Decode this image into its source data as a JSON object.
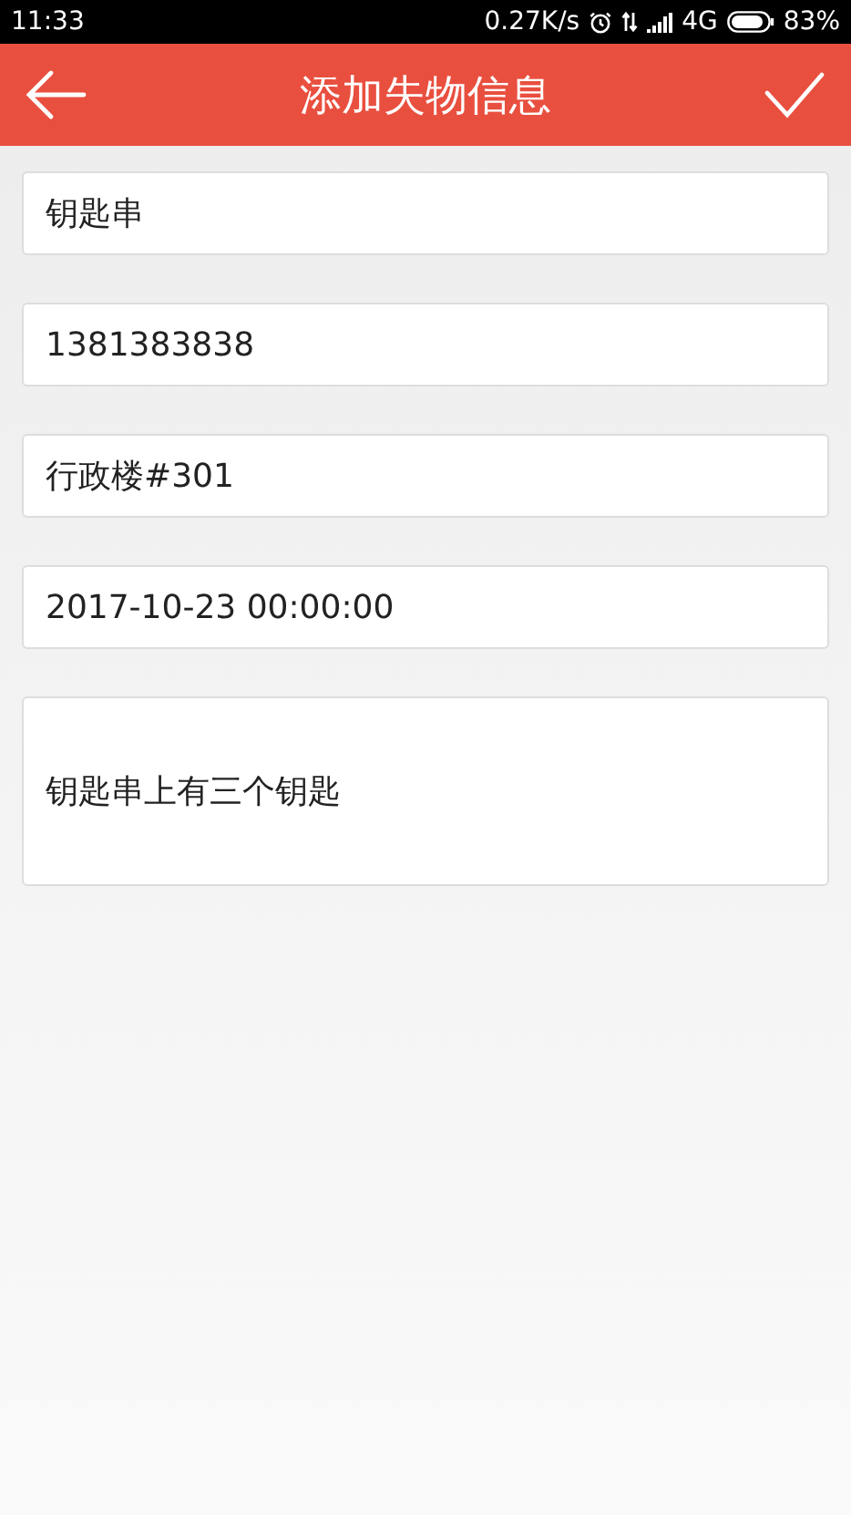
{
  "status_bar": {
    "time": "11:33",
    "speed": "0.27K/s",
    "network": "4G",
    "battery": "83%"
  },
  "header": {
    "title": "添加失物信息"
  },
  "fields": [
    {
      "kind": "single",
      "value": "钥匙串"
    },
    {
      "kind": "single",
      "value": "1381383838"
    },
    {
      "kind": "single",
      "value": "行政楼#301"
    },
    {
      "kind": "single",
      "value": "2017-10-23 00:00:00"
    },
    {
      "kind": "multi",
      "value": "钥匙串上有三个钥匙"
    }
  ]
}
